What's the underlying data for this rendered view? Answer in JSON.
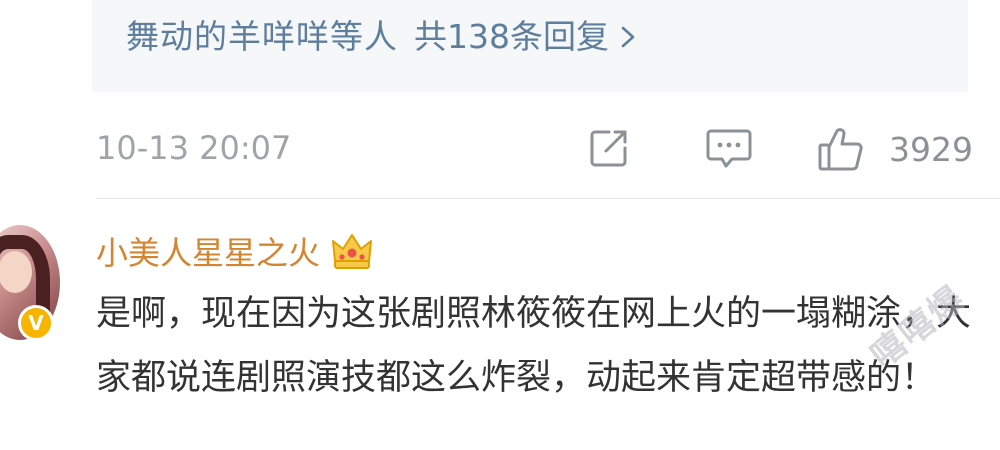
{
  "reply_summary": {
    "users": "舞动的羊咩咩等人",
    "count": "共138条回复"
  },
  "meta": {
    "timestamp": "10-13 20:07",
    "like_count": "3929"
  },
  "comment": {
    "username": "小美人星星之火",
    "verified_badge": "V",
    "text": "是啊，现在因为这张剧照林筱筱在网上火的一塌糊涂，大家都说连剧照演技都这么炸裂，动起来肯定超带感的！"
  },
  "watermark": "嘻嘻爆"
}
